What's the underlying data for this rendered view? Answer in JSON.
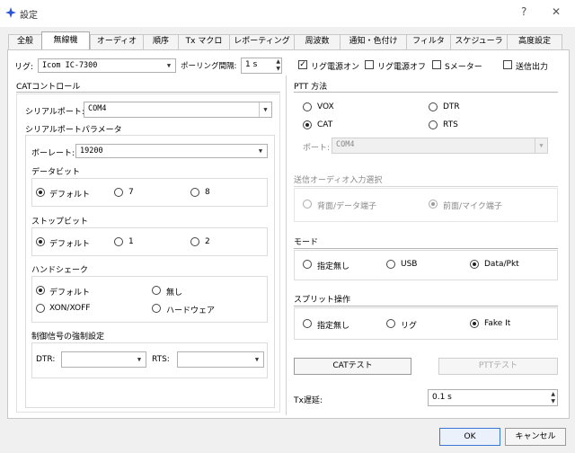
{
  "window": {
    "title": "設定",
    "help": "?",
    "close": "✕"
  },
  "tabs": [
    "全般",
    "無線機",
    "オーディオ",
    "順序",
    "Tx マクロ",
    "レポーティング",
    "周波数",
    "通知・色付け",
    "フィルタ",
    "スケジューラ",
    "高度設定"
  ],
  "rig": {
    "label": "リグ:",
    "value": "Icom IC-7300",
    "poll_label": "ポーリング間隔:",
    "poll_value": "1 s",
    "rig_power_on": "リグ電源オン",
    "rig_power_off": "リグ電源オフ",
    "s_meter": "Sメーター",
    "tx_output": "送信出力"
  },
  "cat": {
    "title": "CATコントロール",
    "serial_port_label": "シリアルポート:",
    "serial_port_value": "COM4",
    "params_title": "シリアルポートパラメータ",
    "baud_label": "ボーレート:",
    "baud_value": "19200",
    "data_bits": {
      "title": "データビット",
      "opts": [
        "デフォルト",
        "7",
        "8"
      ]
    },
    "stop_bits": {
      "title": "ストップビット",
      "opts": [
        "デフォルト",
        "1",
        "2"
      ]
    },
    "handshake": {
      "title": "ハンドシェーク",
      "opts": [
        "デフォルト",
        "無し",
        "XON/XOFF",
        "ハードウェア"
      ]
    },
    "force": {
      "title": "制御信号の強制設定",
      "dtr": "DTR:",
      "rts": "RTS:"
    }
  },
  "ptt": {
    "title": "PTT 方法",
    "vox": "VOX",
    "dtr": "DTR",
    "cat": "CAT",
    "rts": "RTS",
    "port_label": "ポート:",
    "port_value": "COM4"
  },
  "audio_src": {
    "title": "送信オーディオ入力選択",
    "rear": "背面/データ端子",
    "front": "前面/マイク端子"
  },
  "mode": {
    "title": "モード",
    "none": "指定無し",
    "usb": "USB",
    "data": "Data/Pkt"
  },
  "split": {
    "title": "スプリット操作",
    "none": "指定無し",
    "rig": "リグ",
    "fake": "Fake It"
  },
  "buttons": {
    "cat_test": "CATテスト",
    "ptt_test": "PTTテスト",
    "ok": "OK",
    "cancel": "キャンセル"
  },
  "tx_delay": {
    "label": "Tx遅延:",
    "value": "0.1 s"
  }
}
